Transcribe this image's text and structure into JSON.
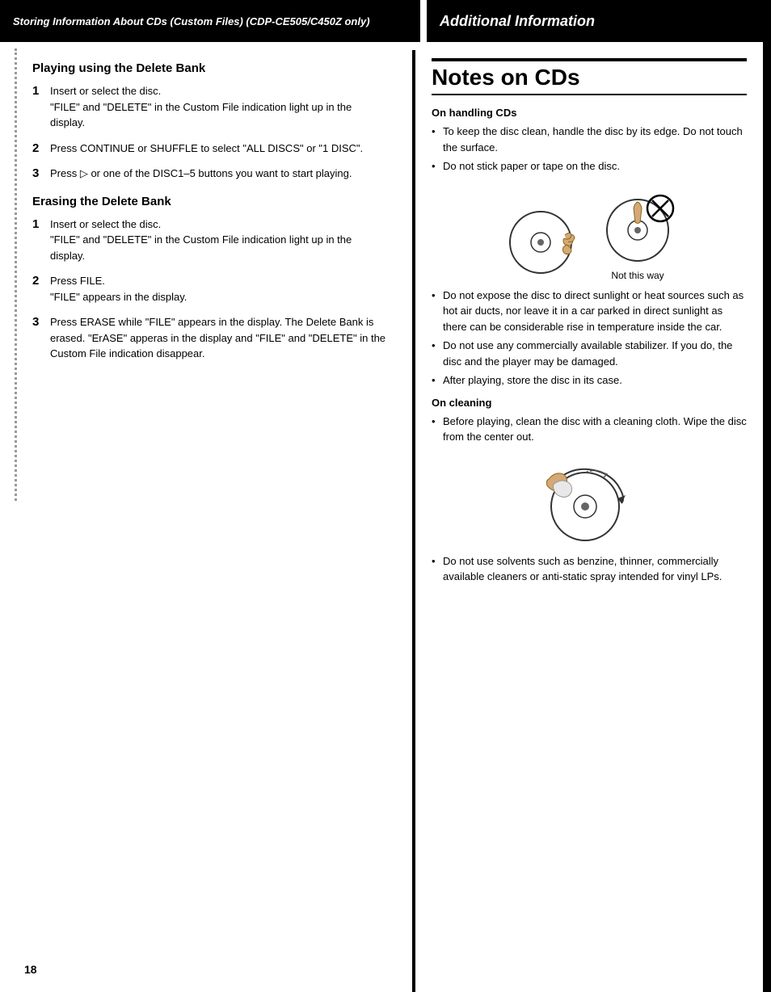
{
  "header": {
    "left_label": "Storing Information About CDs (Custom Files) (CDP-CE505/C450Z only)",
    "right_label": "Additional Information"
  },
  "left_column": {
    "section1_heading": "Playing using the Delete Bank",
    "section1_items": [
      {
        "num": "1",
        "text": "Insert or select the disc.\n\"FILE\" and \"DELETE\" in the Custom File indication light up in the display."
      },
      {
        "num": "2",
        "text": "Press CONTINUE or SHUFFLE to select \"ALL DISCS\" or \"1 DISC\"."
      },
      {
        "num": "3",
        "text": "Press ▷ or one of the DISC1–5 buttons you want to start playing."
      }
    ],
    "section2_heading": "Erasing the Delete Bank",
    "section2_items": [
      {
        "num": "1",
        "text": "Insert or select the disc.\n\"FILE\" and \"DELETE\" in the Custom File indication light up in the display."
      },
      {
        "num": "2",
        "text": "Press FILE.\n\"FILE\" appears in the display."
      },
      {
        "num": "3",
        "text": "Press ERASE while \"FILE\" appears in the display. The Delete Bank is erased. \"ErASE\" apperas in the display and \"FILE\" and \"DELETE\" in the Custom File indication disappear."
      }
    ]
  },
  "right_column": {
    "main_title": "Notes on CDs",
    "handling_heading": "On handling CDs",
    "handling_bullets": [
      "To keep the disc clean, handle the disc by its edge. Do not touch the surface.",
      "Do not stick paper or tape on the disc."
    ],
    "cd_caption_ok": "",
    "cd_caption_bad": "Not this way",
    "handling_bullets2": [
      "Do not expose the disc to direct sunlight or heat sources such as hot air ducts, nor leave it in a car parked in direct sunlight as there can be considerable rise in temperature inside the car.",
      "Do not use any commercially available stabilizer. If you do, the disc and the player may be damaged.",
      "After playing, store the disc in its case."
    ],
    "cleaning_heading": "On cleaning",
    "cleaning_bullets": [
      "Before playing, clean the disc with a cleaning cloth. Wipe the disc from the center out."
    ],
    "cleaning_bullets2": [
      "Do not use solvents such as benzine, thinner, commercially available cleaners or anti-static spray intended for vinyl LPs."
    ]
  },
  "page_number": "18"
}
